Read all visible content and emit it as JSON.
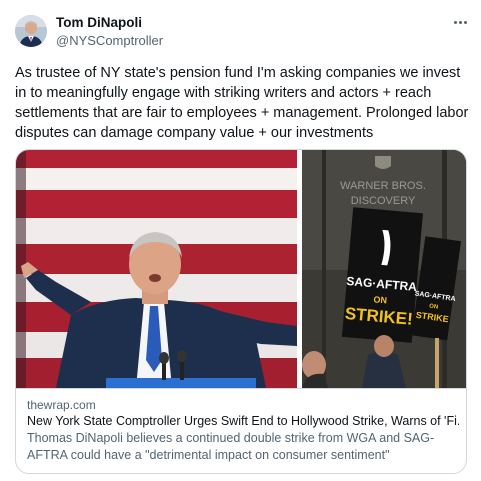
{
  "author": {
    "name": "Tom DiNapoli",
    "handle": "@NYSComptroller"
  },
  "tweet": {
    "text": "As trustee of NY state's pension fund I'm asking companies we invest in to meaningfully engage with striking writers and actors + reach settlements that are fair to employees + management. Prolonged labor disputes can damage company value + our investments"
  },
  "card": {
    "domain": "thewrap.com",
    "title": "New York State Comptroller Urges Swift End to Hollywood Strike, Warns of 'Fi...",
    "description": "Thomas DiNapoli believes a continued double strike from WGA and SAG-AFTRA could have a \"detrimental impact on consumer sentiment\""
  },
  "photo_right": {
    "building_sign_line1": "WARNER BROS.",
    "building_sign_line2": "DISCOVERY",
    "picket_sign_line1": "SAG·AFTRA",
    "picket_sign_line2": "ON",
    "picket_sign_line3": "STRIKE!",
    "picket_sign2_line1": "SAG·AFTRA",
    "picket_sign2_line2": "ON",
    "picket_sign2_line3": "STRIKE"
  },
  "colors": {
    "handle": "#536471",
    "border": "#cfd9de",
    "flag_red": "#b22234",
    "sign_yellow": "#f3c21a"
  },
  "icons": {
    "more": "more-horizontal-icon"
  }
}
